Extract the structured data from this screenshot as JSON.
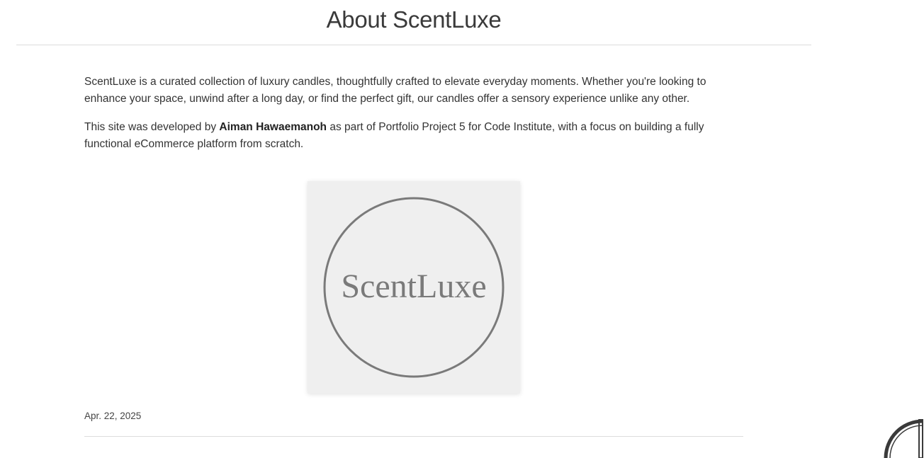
{
  "page": {
    "title": "About ScentLuxe"
  },
  "intro": {
    "paragraph_1": "ScentLuxe is a curated collection of luxury candles, thoughtfully crafted to elevate everyday moments. Whether you're looking to enhance your space, unwind after a long day, or find the perfect gift, our candles offer a sensory experience unlike any other.",
    "paragraph_2_before": "This site was developed by ",
    "paragraph_2_author": "Aiman Hawaemanoh",
    "paragraph_2_after": " as part of Portfolio Project 5 for Code Institute, with a focus on building a fully functional eCommerce platform from scratch."
  },
  "logo": {
    "text": "ScentLuxe",
    "icon": "brand-logo-icon",
    "ring_color": "#7a7a7a",
    "background_color": "#efefef"
  },
  "post": {
    "date": "Apr. 22, 2025"
  },
  "corner_widget": {
    "icon": "quarter-circle-icon",
    "color": "#3a3a3a"
  }
}
